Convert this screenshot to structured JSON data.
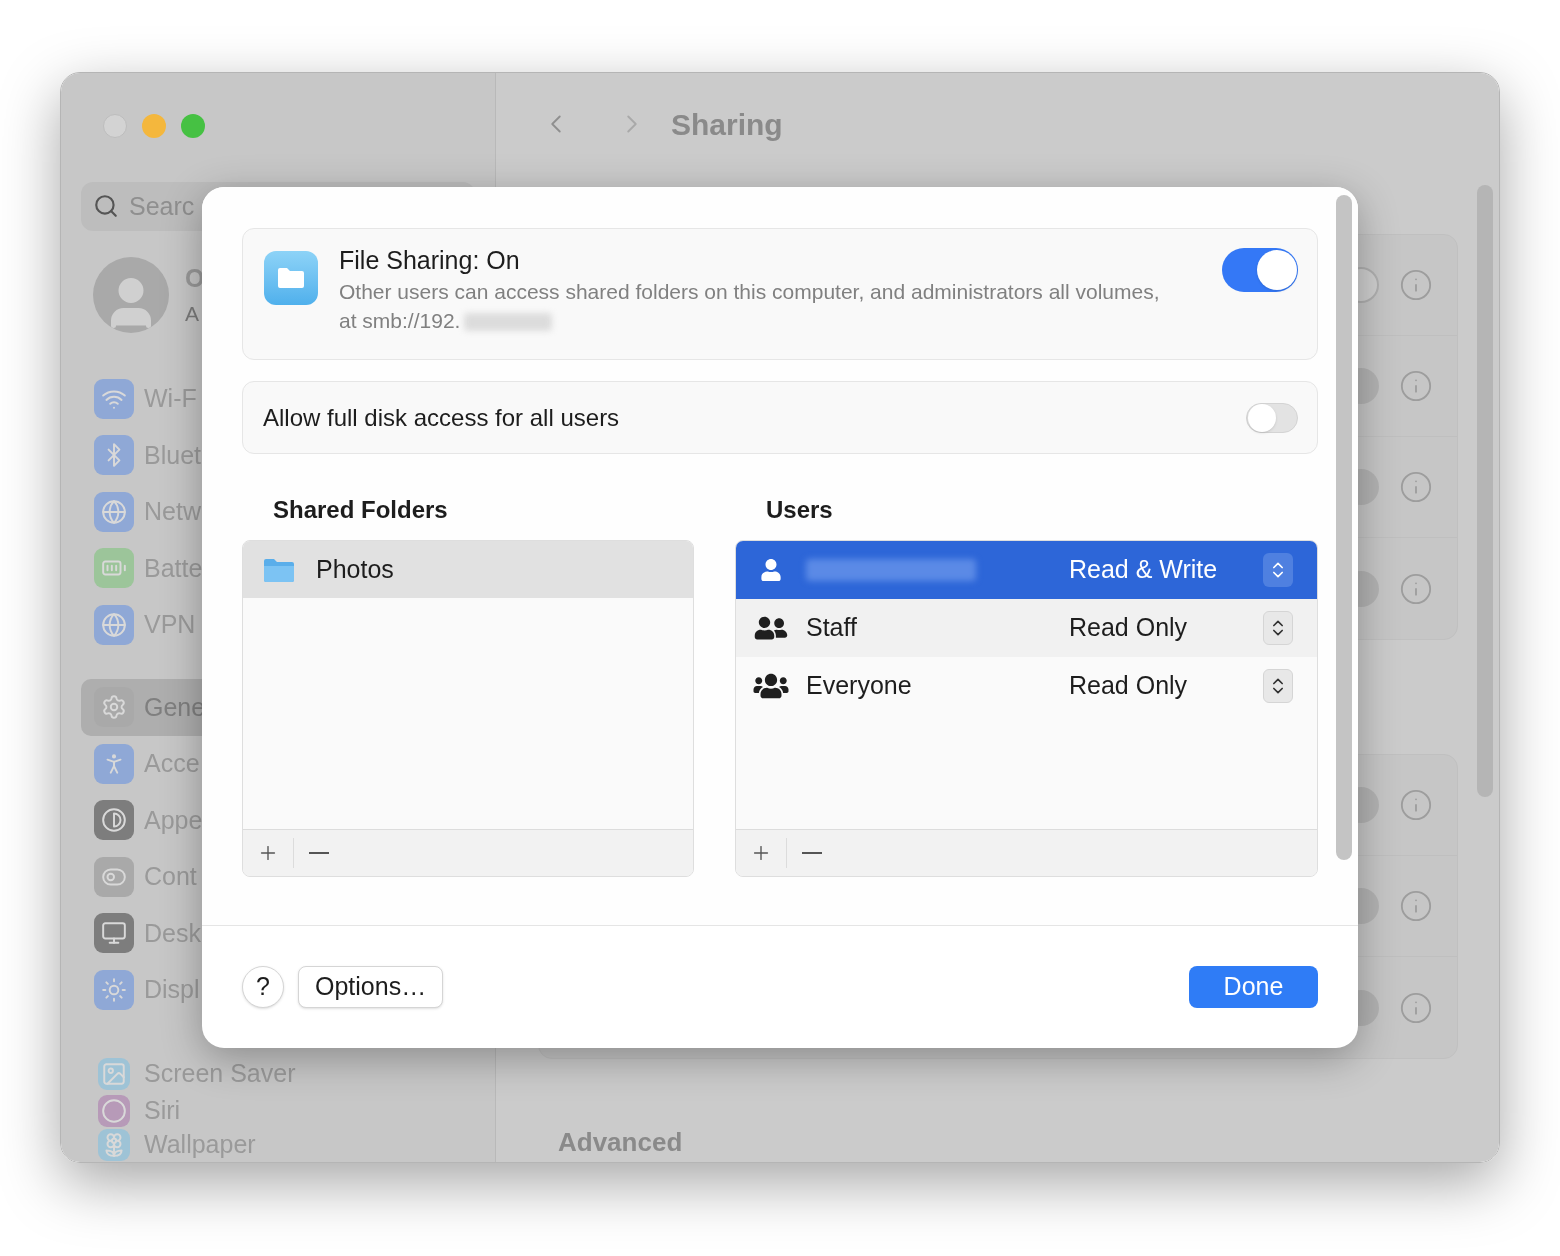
{
  "toolbar": {
    "title": "Sharing"
  },
  "sidebar": {
    "search": {
      "placeholder": "Searc"
    },
    "account": {
      "name": "O",
      "subtitle": "A"
    },
    "items": [
      {
        "label": "Wi-F",
        "color": "#8fa8d6",
        "selected": false
      },
      {
        "label": "Bluet",
        "color": "#8fa8d6",
        "selected": false
      },
      {
        "label": "Netw",
        "color": "#8fa8d6",
        "selected": false
      },
      {
        "label": "Batte",
        "color": "#9cc59a",
        "selected": false
      },
      {
        "label": "VPN",
        "color": "#8fa8d6",
        "selected": false
      },
      {
        "label": "Gene",
        "color": "#a9a9a9",
        "selected": true
      },
      {
        "label": "Acce",
        "color": "#8fa8d6",
        "selected": false
      },
      {
        "label": "Appe",
        "color": "#7d7d7d",
        "selected": false
      },
      {
        "label": "Cont",
        "color": "#a9a9a9",
        "selected": false
      },
      {
        "label": "Desk",
        "color": "#7d7d7d",
        "selected": false
      },
      {
        "label": "Displ",
        "color": "#8fa8d6",
        "selected": false
      },
      {
        "label": "Screen Saver",
        "color": "#9ec3d6",
        "selected": false
      },
      {
        "label": "Siri",
        "color": "#b79ab8",
        "selected": false
      },
      {
        "label": "Wallpaper",
        "color": "#9ec3d6",
        "selected": false
      }
    ]
  },
  "sections": [
    {
      "rows": [
        {
          "on": false
        },
        {
          "on": true
        },
        {
          "on": true
        },
        {
          "on": true
        }
      ]
    },
    {
      "rows": [
        {
          "on": true
        },
        {
          "on": true
        },
        {
          "on": true
        }
      ]
    }
  ],
  "advanced_heading": "Advanced",
  "dialog": {
    "file_sharing": {
      "title": "File Sharing: On",
      "description": "Other users can access shared folders on this computer, and administrators all volumes, at smb://192.",
      "on": true
    },
    "full_disk_access": {
      "label": "Allow full disk access for all users",
      "on": false
    },
    "shared_folders": {
      "heading": "Shared Folders",
      "items": [
        {
          "name": "Photos",
          "selected": true
        }
      ]
    },
    "users": {
      "heading": "Users",
      "items": [
        {
          "kind": "user",
          "permission": "Read & Write",
          "selected": true
        },
        {
          "kind": "group",
          "name": "Staff",
          "permission": "Read Only",
          "selected": false
        },
        {
          "kind": "everyone",
          "name": "Everyone",
          "permission": "Read Only",
          "selected": false
        }
      ]
    },
    "buttons": {
      "help": "?",
      "options": "Options…",
      "done": "Done"
    }
  }
}
